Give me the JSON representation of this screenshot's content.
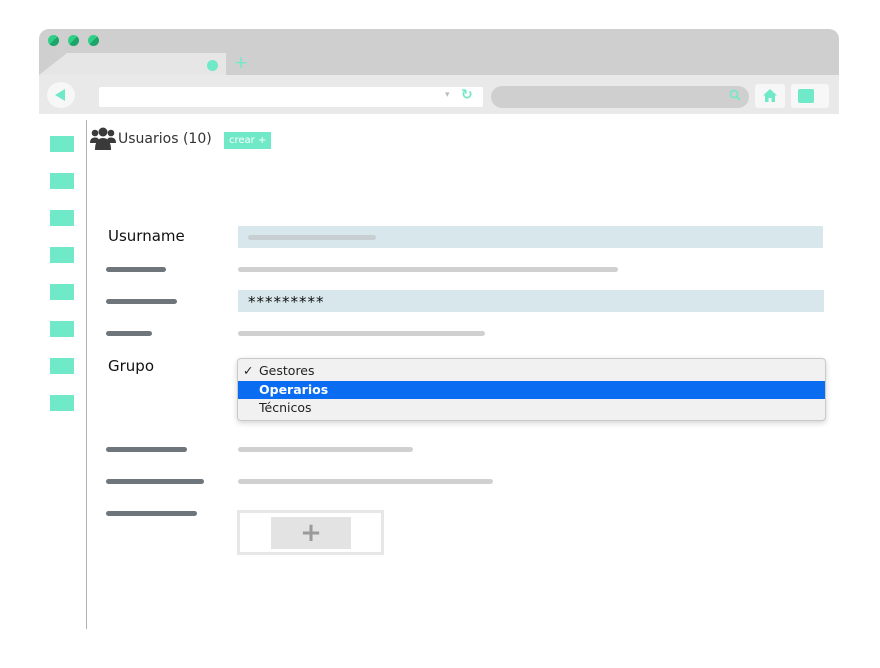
{
  "browser": {
    "new_tab_glyph": "+",
    "dropdown_glyph": "▾",
    "reload_glyph": "↻"
  },
  "header": {
    "title": "Usuarios (10)",
    "create_label": "crear +",
    "icon": "users-icon"
  },
  "form": {
    "username_label": "Usurname",
    "password_value": "*********",
    "group_label": "Grupo",
    "group_options": [
      "Gestores",
      "Operarios",
      "Técnicos"
    ],
    "group_checked": "Gestores",
    "group_highlighted": "Operarios",
    "check_glyph": "✓",
    "add_glyph": "+"
  },
  "colors": {
    "accent": "#6fe9c7",
    "field_bg": "#d7e7ec",
    "selection": "#0a6cf0"
  }
}
